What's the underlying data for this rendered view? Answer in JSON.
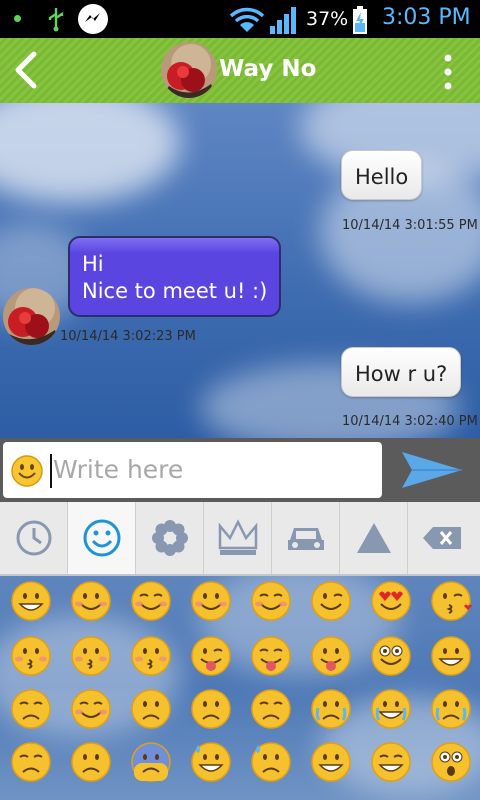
{
  "status_bar": {
    "battery_percent": "37%",
    "time": "3:03 PM",
    "icons": [
      "notification-dot-icon",
      "usb-icon",
      "messenger-icon",
      "wifi-icon",
      "signal-icon",
      "battery-charging-icon"
    ]
  },
  "header": {
    "contact_name": "Way No",
    "icons": [
      "back-arrow-icon",
      "contact-avatar",
      "overflow-menu-icon"
    ]
  },
  "messages": [
    {
      "direction": "outgoing",
      "lines": [
        "Hello"
      ],
      "timestamp": "10/14/14 3:01:55 PM"
    },
    {
      "direction": "incoming",
      "lines": [
        "Hi",
        "Nice to meet u! :)"
      ],
      "timestamp": "10/14/14 3:02:23 PM"
    },
    {
      "direction": "outgoing",
      "lines": [
        "How r u?"
      ],
      "timestamp": "10/14/14 3:02:40 PM"
    }
  ],
  "composer": {
    "placeholder": "Write here",
    "icons": [
      "smiley-icon",
      "send-icon"
    ]
  },
  "emoji_tabs": [
    {
      "icon": "recent-clock-icon"
    },
    {
      "icon": "smiley-face-icon",
      "active": true
    },
    {
      "icon": "flower-icon"
    },
    {
      "icon": "crown-icon"
    },
    {
      "icon": "car-icon"
    },
    {
      "icon": "triangle-icon"
    },
    {
      "icon": "backspace-icon"
    }
  ],
  "colors": {
    "header_green": "#7ab934",
    "incoming_bubble": "#5a45e0",
    "outgoing_bubble": "#f2f2f2",
    "accent_blue": "#59b9ff"
  }
}
